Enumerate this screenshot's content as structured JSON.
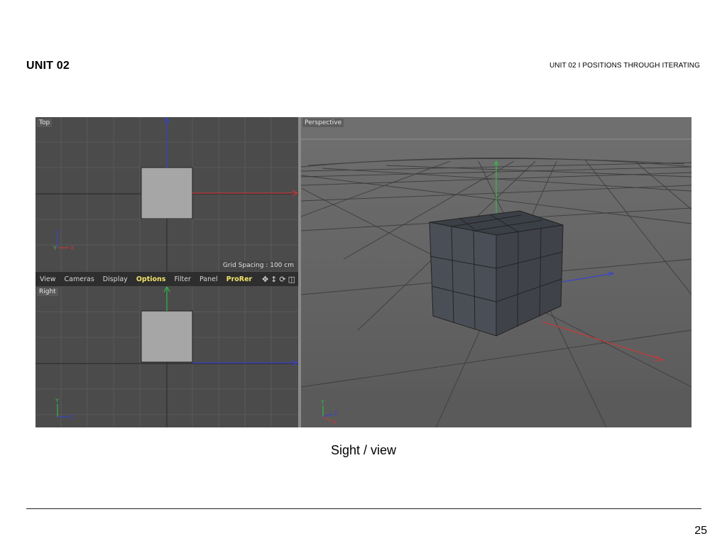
{
  "slide": {
    "header_left": "UNIT 02",
    "header_right": "UNIT 02 I POSITIONS THROUGH ITERATING",
    "caption": "Sight / view",
    "page_number": "25"
  },
  "viewports": {
    "top": {
      "label": "Top",
      "grid_spacing": "Grid Spacing : 100 cm"
    },
    "right": {
      "label": "Right"
    },
    "perspective": {
      "label": "Perspective"
    }
  },
  "menu": {
    "items": [
      "View",
      "Cameras",
      "Display",
      "Options",
      "Filter",
      "Panel",
      "ProRer"
    ],
    "highlighted": [
      "Options",
      "ProRer"
    ],
    "icons": [
      "move-view-icon",
      "dolly-view-icon",
      "rotate-view-icon",
      "toggle-layout-icon"
    ]
  },
  "axes": {
    "top_view": {
      "vertical": "Z",
      "horizontal": "X"
    },
    "top_view_extra": "Y",
    "right_view": {
      "vertical": "Y",
      "horizontal": "Z"
    },
    "perspective_view": {
      "vertical": "Y",
      "horizontal": "Z",
      "extra": "X"
    }
  },
  "colors": {
    "axis_x": "#c43a3a",
    "axis_y": "#33b84a",
    "axis_z": "#3a45c8",
    "highlight": "#f3e36a"
  }
}
